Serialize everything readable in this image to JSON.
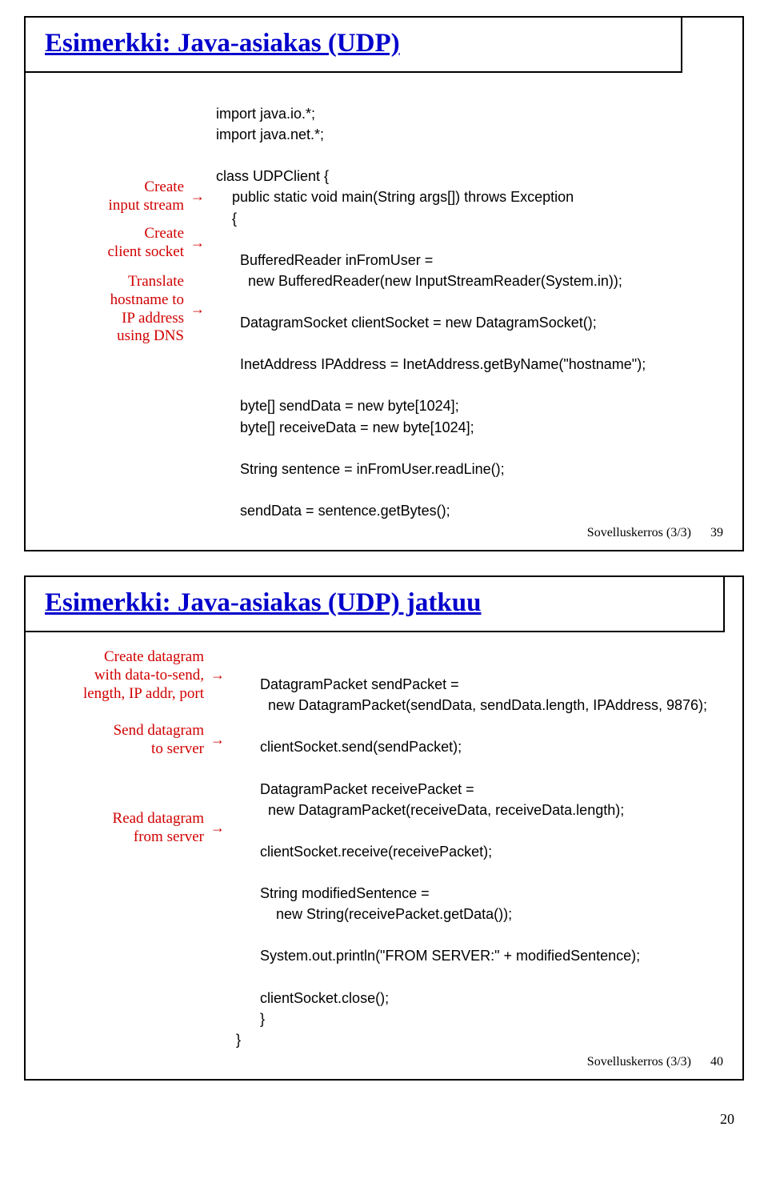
{
  "slide1": {
    "title": "Esimerkki: Java-asiakas (UDP)",
    "labels": {
      "create_input": "Create\ninput stream",
      "create_socket": "Create\nclient socket",
      "translate": "Translate\nhostname to\nIP address\nusing DNS"
    },
    "code": {
      "l01": "import java.io.*;",
      "l02": "import java.net.*;",
      "l03": "class UDPClient {",
      "l04": "    public static void main(String args[]) throws Exception",
      "l05": "    {",
      "l06": "      BufferedReader inFromUser =",
      "l07": "        new BufferedReader(new InputStreamReader(System.in));",
      "l08": "      DatagramSocket clientSocket = new DatagramSocket();",
      "l09": "      InetAddress IPAddress = InetAddress.getByName(\"hostname\");",
      "l10": "      byte[] sendData = new byte[1024];",
      "l11": "      byte[] receiveData = new byte[1024];",
      "l12": "      String sentence = inFromUser.readLine();",
      "l13": "      sendData = sentence.getBytes();"
    },
    "footer_label": "Sovelluskerros (3/3)",
    "footer_page": "39"
  },
  "slide2": {
    "title": "Esimerkki: Java-asiakas (UDP) jatkuu",
    "labels": {
      "create_dgram": "Create datagram\nwith data-to-send,\nlength, IP addr, port",
      "send": "Send datagram\nto server",
      "read": "Read datagram\nfrom server"
    },
    "code": {
      "l01": "      DatagramPacket sendPacket =",
      "l02": "        new DatagramPacket(sendData, sendData.length, IPAddress, 9876);",
      "l03": "      clientSocket.send(sendPacket);",
      "l04": "      DatagramPacket receivePacket =",
      "l05": "        new DatagramPacket(receiveData, receiveData.length);",
      "l06": "      clientSocket.receive(receivePacket);",
      "l07": "      String modifiedSentence =",
      "l08": "          new String(receivePacket.getData());",
      "l09": "      System.out.println(\"FROM SERVER:\" + modifiedSentence);",
      "l10": "      clientSocket.close();",
      "l11": "      }",
      "l12": "}"
    },
    "footer_label": "Sovelluskerros (3/3)",
    "footer_page": "40"
  },
  "doc_page": "20"
}
